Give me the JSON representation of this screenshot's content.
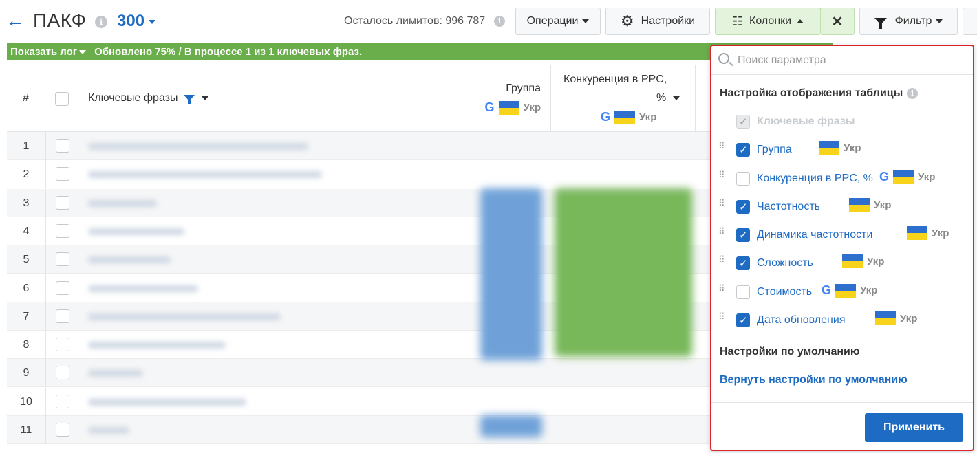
{
  "header": {
    "title": "ПАКФ",
    "project_num": "300",
    "limits_text": "Осталось лимитов: 996 787",
    "buttons": {
      "operations": "Операции",
      "settings": "Настройки",
      "columns": "Колонки",
      "filter": "Фильтр"
    }
  },
  "logbar": {
    "show_log": "Показать лог",
    "status": "Обновлено 75% / В процессе 1 из 1 ключевых фраз."
  },
  "table": {
    "headers": {
      "num": "#",
      "keywords": "Ключевые фразы",
      "group": "Группа",
      "group_region": "Укр",
      "ppc_line1": "Конкуренция в PPC,",
      "ppc_line2": "%",
      "ppc_region": "Укр",
      "google_letter": "G"
    },
    "rows": [
      "1",
      "2",
      "3",
      "4",
      "5",
      "6",
      "7",
      "8",
      "9",
      "10",
      "11"
    ]
  },
  "panel": {
    "search_placeholder": "Поиск параметра",
    "title": "Настройка отображения таблицы",
    "options": [
      {
        "label": "Ключевые фразы",
        "checked": true,
        "disabled": true
      },
      {
        "label": "Группа",
        "checked": true,
        "region": "Укр",
        "google": false
      },
      {
        "label": "Конкуренция в PPC, %",
        "checked": false,
        "region": "Укр",
        "google": true
      },
      {
        "label": "Частотность",
        "checked": true,
        "region": "Укр",
        "google": false
      },
      {
        "label": "Динамика частотности",
        "checked": true,
        "region": "Укр",
        "google": false
      },
      {
        "label": "Сложность",
        "checked": true,
        "region": "Укр",
        "google": false
      },
      {
        "label": "Стоимость",
        "checked": false,
        "region": "Укр",
        "google": true
      },
      {
        "label": "Дата обновления",
        "checked": true,
        "region": "Укр",
        "google": false
      }
    ],
    "defaults_title": "Настройки по умолчанию",
    "reset_link": "Вернуть настройки по умолчанию",
    "apply": "Применить"
  },
  "colors": {
    "accent": "#1e6bc3",
    "logbar": "#6aad4b",
    "panel_border": "#d9232d",
    "flag_top": "#2e6fce",
    "flag_bottom": "#f7d41b"
  }
}
